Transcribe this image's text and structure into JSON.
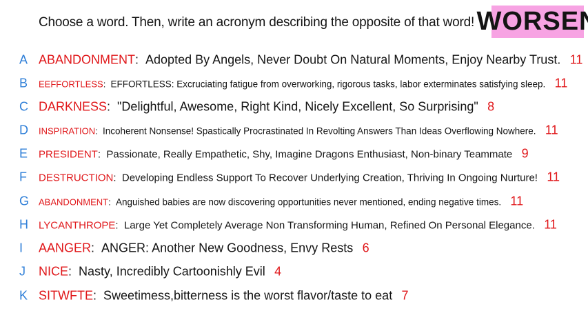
{
  "prompt": "Choose a word. Then, write an acronym describing the opposite of that word!",
  "badge": "WORSEN",
  "colors": {
    "letter": "#2f7fd8",
    "word": "#e0171a",
    "score": "#e0171a",
    "badge_bg": "#f7a3e3"
  },
  "entries": [
    {
      "letter": "A",
      "word": "ABANDONMENT",
      "text": "Adopted By Angels, Never Doubt On Natural Moments, Enjoy Nearby Trust.",
      "score": "11"
    },
    {
      "letter": "B",
      "word": "EEFFORTLESS",
      "text": "EFFORTLESS: Excruciating fatigue from overworking, rigorous tasks, labor exterminates satisfying sleep.",
      "score": "11"
    },
    {
      "letter": "C",
      "word": "DARKNESS",
      "text": "\"Delightful, Awesome, Right Kind, Nicely Excellent, So Surprising\"",
      "score": "8"
    },
    {
      "letter": "D",
      "word": "INSPIRATION",
      "text": "Incoherent Nonsense! Spastically Procrastinated In Revolting Answers Than Ideas Overflowing Nowhere.",
      "score": "11"
    },
    {
      "letter": "E",
      "word": "PRESIDENT",
      "text": "Passionate, Really Empathetic, Shy, Imagine Dragons Enthusiast, Non-binary Teammate",
      "score": "9"
    },
    {
      "letter": "F",
      "word": "DESTRUCTION",
      "text": "Developing Endless Support To Recover Underlying Creation, Thriving In Ongoing Nurture!",
      "score": "11"
    },
    {
      "letter": "G",
      "word": "ABANDONMENT",
      "text": "Anguished babies are now discovering opportunities never mentioned, ending negative times.",
      "score": "11"
    },
    {
      "letter": "H",
      "word": "LYCANTHROPE",
      "text": "Large Yet Completely Average Non Transforming Human, Refined On Personal Elegance.",
      "score": "11"
    },
    {
      "letter": "I",
      "word": "AANGER",
      "text": "ANGER: Another New Goodness, Envy Rests",
      "score": "6"
    },
    {
      "letter": "J",
      "word": "NICE",
      "text": "Nasty, Incredibly Cartoonishly Evil",
      "score": "4"
    },
    {
      "letter": "K",
      "word": "SITWFTE",
      "text": "Sweetimess,bitterness is the worst flavor/taste to eat",
      "score": "7"
    }
  ]
}
